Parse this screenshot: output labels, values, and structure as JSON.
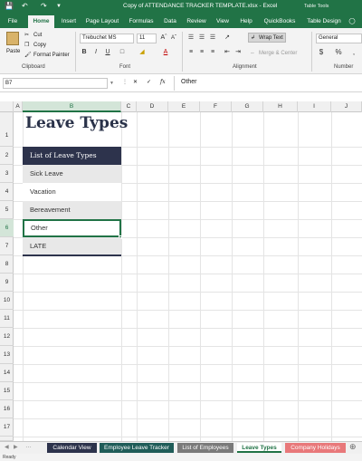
{
  "app": {
    "title": "Copy of ATTENDANCE TRACKER TEMPLATE.xlsx  -  Excel",
    "context_group": "Table Tools",
    "accent_color": "#217346"
  },
  "quick_access": {
    "save_icon": "save-icon",
    "undo_icon": "undo-icon",
    "redo_icon": "redo-icon"
  },
  "tabs": [
    "File",
    "Home",
    "Insert",
    "Page Layout",
    "Formulas",
    "Data",
    "Review",
    "View",
    "Help",
    "QuickBooks",
    "Table Design"
  ],
  "tab_tell_me_icon": "lightbulb-icon",
  "ribbon": {
    "clipboard": {
      "label": "Clipboard",
      "paste": "Paste",
      "cut": "Cut",
      "copy": "Copy",
      "format_painter": "Format Painter"
    },
    "font": {
      "label": "Font",
      "font_name": "Trebuchet MS",
      "font_size": "11",
      "bold": "B",
      "italic": "I",
      "underline": "U",
      "font_color_letter": "A"
    },
    "alignment": {
      "label": "Alignment",
      "wrap_text": "Wrap Text",
      "merge_center": "Merge & Center"
    },
    "number": {
      "label": "Number",
      "format": "General",
      "currency": "$",
      "percent": "%",
      "comma": ","
    }
  },
  "formula_bar": {
    "name_box": "B7",
    "fx": "fx",
    "value": "Other"
  },
  "grid": {
    "columns": [
      "A",
      "B",
      "C",
      "D",
      "E",
      "F",
      "G",
      "H",
      "I",
      "J"
    ],
    "rows": [
      "1",
      "2",
      "3",
      "4",
      "5",
      "6",
      "7",
      "8",
      "9",
      "10",
      "11",
      "12",
      "13",
      "14",
      "15",
      "16",
      "17",
      "18"
    ],
    "selected_column": "B",
    "selected_row": "7"
  },
  "sheet": {
    "title": "Leave Types",
    "table_header": "List of Leave Types",
    "items": [
      "Sick Leave",
      "Vacation",
      "Bereavement",
      "Other",
      "LATE"
    ],
    "selected_item": "Other"
  },
  "sheet_tabs": [
    {
      "label": "Calendar View",
      "color": "#2d334c",
      "active": false
    },
    {
      "label": "Employee Leave Tracker",
      "color": "#1f5c58",
      "active": false
    },
    {
      "label": "List of Employees",
      "color": "#7a7a7a",
      "active": false
    },
    {
      "label": "Leave Types",
      "color": "#ffffff",
      "active": true
    },
    {
      "label": "Company Holidays",
      "color": "#e8787a",
      "active": false
    }
  ],
  "status": {
    "text": "Ready"
  }
}
